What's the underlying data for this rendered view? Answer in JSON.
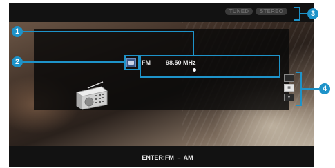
{
  "status": {
    "tuned": "TUNED",
    "stereo": "STEREO"
  },
  "tuner": {
    "band": "FM",
    "frequency": "98.50 MHz",
    "tuning_position": 0.53
  },
  "footer": {
    "hint": "ENTER:FM ⇔ AM"
  },
  "callouts": {
    "c1": "1",
    "c2": "2",
    "c3": "3",
    "c4": "4"
  },
  "icons": {
    "album": "album-art-icon",
    "radio": "radio-icon",
    "option": "option-menu-icon",
    "list": "list-icon",
    "close": "close-icon"
  },
  "colors": {
    "callout": "#1e93c9",
    "panel": "#080808",
    "text": "#e6e6e6"
  }
}
